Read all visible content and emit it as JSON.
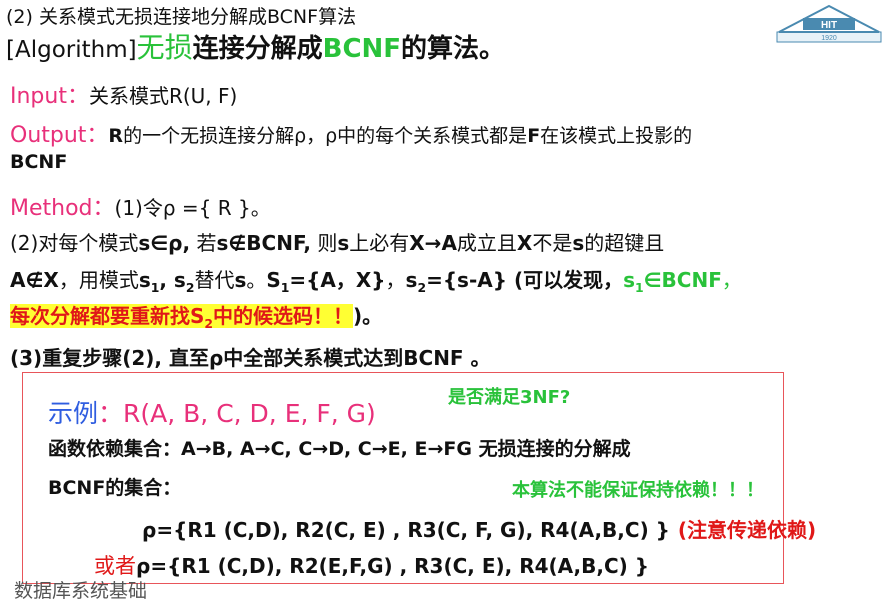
{
  "header": {
    "line1": "(2) 关系模式无损连接地分解成BCNF算法",
    "line2_prefix": "[Algorithm]",
    "line2_green": "无损",
    "line2_mid": "连接分解成",
    "line2_green2": "BCNF",
    "line2_suffix": "的算法。"
  },
  "logo": {
    "text_hit": "HIT",
    "text_year": "1920"
  },
  "input": {
    "label": "Input：",
    "text": "关系模式R(U, F)"
  },
  "output": {
    "label": "Output：",
    "text1_b": "R",
    "text1": "的一个无损连接分解ρ，ρ中的每个关系模式都是",
    "text1_b2": "F",
    "text1_end": "在该模式上投影的",
    "text2": "BCNF"
  },
  "method": {
    "label": "Method：",
    "text": "(1)令ρ ={ R }。"
  },
  "step2": {
    "line1_a": "(2)对每个模式",
    "line1_b": "s∈ρ,",
    "line1_c": "   若",
    "line1_d": "s∉BCNF,",
    "line1_e": "   则",
    "line1_f": "s",
    "line1_g": "上必有",
    "line1_h": "X→A",
    "line1_i": "成立且",
    "line1_j": "X",
    "line1_k": "不是",
    "line1_l": "s",
    "line1_m": "的超键且",
    "line2_a": "A∉X",
    "line2_b": "，用模式",
    "line2_c": "s",
    "line2_c_sub": "1",
    "line2_d": ",   s",
    "line2_d_sub": "2",
    "line2_e": "替代",
    "line2_f": "s",
    "line2_g": "。",
    "line2_h": "S",
    "line2_h_sub": "1",
    "line2_i": "={A，X}",
    "line2_j": "，",
    "line2_k": "s",
    "line2_k_sub": "2",
    "line2_l": "={s-A}",
    "line2_m": "  (可以发现，",
    "line2_n": "s",
    "line2_n_sub": "1",
    "line2_o": "∈BCNF",
    "line2_p": "，",
    "line3_hl": "每次分解都要重新找S",
    "line3_hl_sub": "2",
    "line3_hl2": "中的候选码！！",
    "line3_end": ")。"
  },
  "step3": {
    "text": "(3)重复步骤(2), 直至ρ中全部关系模式达到BCNF 。"
  },
  "example": {
    "label": "示例",
    "colon": "：",
    "relation": "R(A, B, C, D, E, F, G)",
    "note_3nf": "是否满足3NF?",
    "fd_line": "函数依赖集合：A→B, A→C, C→D,  C→E,  E→FG 无损连接的分解成",
    "fd_line2": "BCNF的集合：",
    "note_dep": "本算法不能保证保持依赖！！！",
    "result1": "ρ={R1 (C,D), R2(C, E) , R3(C, F, G), R4(A,B,C) }",
    "result1_note": "(注意传递依赖)",
    "or_label": "或者",
    "result2": "ρ={R1 (C,D), R2(E,F,G) , R3(C, E), R4(A,B,C) }"
  },
  "footer": {
    "text": "数据库系统基础"
  }
}
